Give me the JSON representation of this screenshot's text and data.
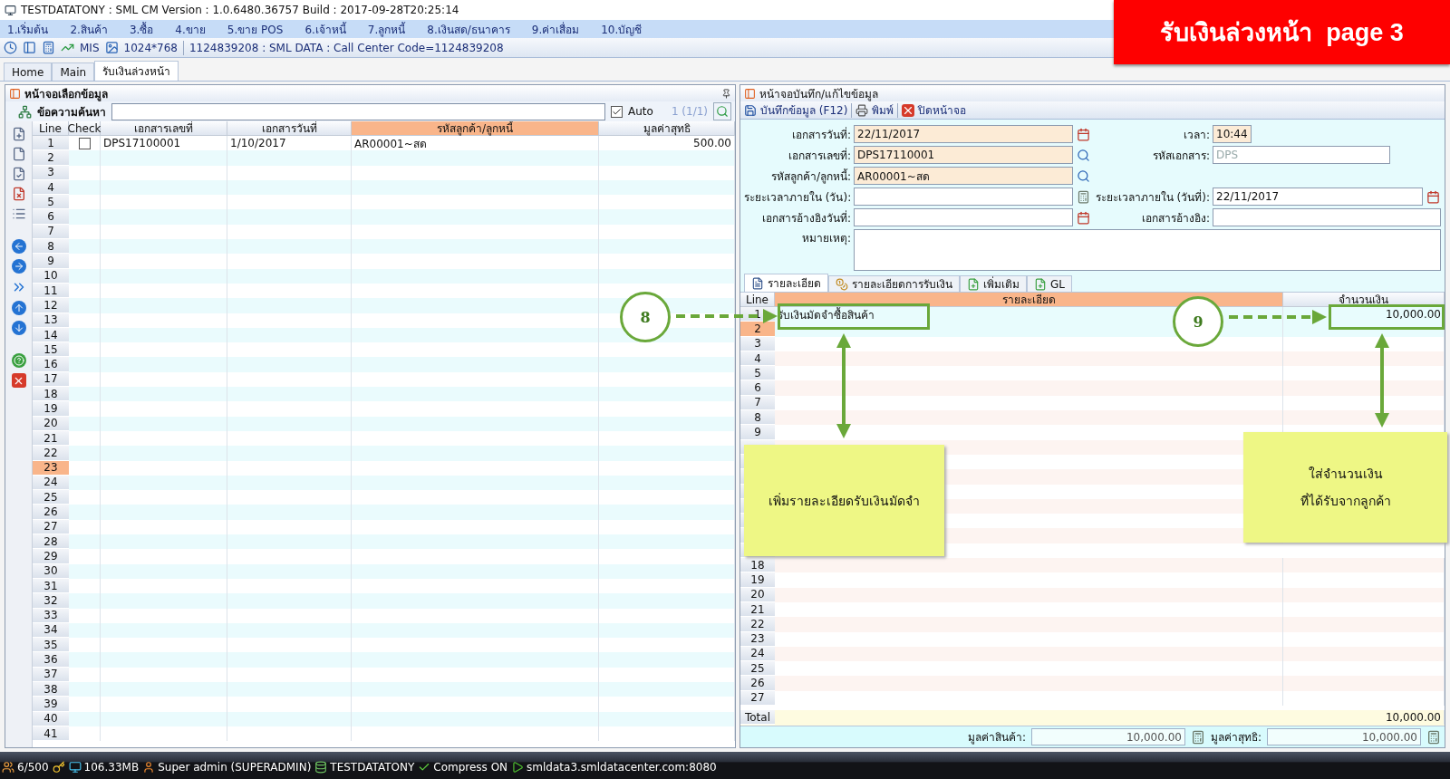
{
  "window": {
    "title": "TESTDATATONY : SML CM Version : 1.0.6480.36757  Build : 2017-09-28T20:25:14"
  },
  "banner": "รับเงินล่วงหน้า  page 3",
  "menu": [
    "1.เริ่มต้น",
    "2.สินค้า",
    "3.ซื้อ",
    "4.ขาย",
    "5.ขาย POS",
    "6.เจ้าหนี้",
    "7.ลูกหนี้",
    "8.เงินสด/ธนาคาร",
    "9.ค่าเสื่อม",
    "10.บัญชี"
  ],
  "toolbar": {
    "mis": "MIS",
    "resolution": "1024*768",
    "info": "1124839208 : SML DATA : Call Center Code=1124839208"
  },
  "tabs": [
    {
      "label": "Home",
      "selected": false
    },
    {
      "label": "Main",
      "selected": false
    },
    {
      "label": "รับเงินล่วงหน้า",
      "selected": true
    }
  ],
  "left_panel": {
    "title": "หน้าจอเลือกข้อมูล",
    "search_label": "ข้อความค้นหา",
    "auto": {
      "label": "Auto",
      "checked": true
    },
    "page_info": "1 (1/1)",
    "columns": [
      {
        "label": "Line",
        "sorted": false
      },
      {
        "label": "Check",
        "sorted": false
      },
      {
        "label": "เอกสารเลขที่",
        "sorted": false
      },
      {
        "label": "เอกสารวันที่",
        "sorted": false
      },
      {
        "label": "รหัสลูกค้า/ลูกหนี้",
        "sorted": true
      },
      {
        "label": "มูลค่าสุทธิ",
        "sorted": false
      }
    ],
    "rows": [
      {
        "line": "1",
        "selected": false,
        "checked": false,
        "doc_no": "DPS17100001",
        "doc_date": "1/10/2017",
        "customer": "AR00001~สด",
        "net_value": "500.00"
      },
      {
        "line": "2",
        "selected": false
      },
      {
        "line": "3",
        "selected": false
      },
      {
        "line": "4",
        "selected": false
      },
      {
        "line": "5",
        "selected": false
      },
      {
        "line": "6",
        "selected": false
      },
      {
        "line": "7",
        "selected": false
      },
      {
        "line": "8",
        "selected": false
      },
      {
        "line": "9",
        "selected": false
      },
      {
        "line": "10",
        "selected": false
      },
      {
        "line": "11",
        "selected": false
      },
      {
        "line": "12",
        "selected": false
      },
      {
        "line": "13",
        "selected": false
      },
      {
        "line": "14",
        "selected": false
      },
      {
        "line": "15",
        "selected": false
      },
      {
        "line": "16",
        "selected": false
      },
      {
        "line": "17",
        "selected": false
      },
      {
        "line": "18",
        "selected": false
      },
      {
        "line": "19",
        "selected": false
      },
      {
        "line": "20",
        "selected": false
      },
      {
        "line": "21",
        "selected": false
      },
      {
        "line": "22",
        "selected": false
      },
      {
        "line": "23",
        "selected": true
      },
      {
        "line": "24",
        "selected": false
      },
      {
        "line": "25",
        "selected": false
      },
      {
        "line": "26",
        "selected": false
      },
      {
        "line": "27",
        "selected": false
      },
      {
        "line": "28",
        "selected": false
      },
      {
        "line": "29",
        "selected": false
      },
      {
        "line": "30",
        "selected": false
      },
      {
        "line": "31",
        "selected": false
      },
      {
        "line": "32",
        "selected": false
      },
      {
        "line": "33",
        "selected": false
      },
      {
        "line": "34",
        "selected": false
      },
      {
        "line": "35",
        "selected": false
      },
      {
        "line": "36",
        "selected": false
      },
      {
        "line": "37",
        "selected": false
      },
      {
        "line": "38",
        "selected": false
      },
      {
        "line": "39",
        "selected": false
      },
      {
        "line": "40",
        "selected": false
      },
      {
        "line": "41",
        "selected": false
      }
    ]
  },
  "right_panel": {
    "title": "หน้าจอบันทึก/แก้ไขข้อมูล",
    "actions": [
      {
        "kind": "save",
        "label": "บันทึกข้อมูล (F12)"
      },
      {
        "kind": "print",
        "label": "พิมพ์"
      },
      {
        "kind": "close",
        "label": "ปิดหน้าจอ"
      }
    ],
    "form_rows": [
      {
        "left": {
          "kind": "date",
          "label": "เอกสารวันที่:",
          "value": "22/11/2017",
          "required": true
        },
        "right": {
          "kind": "text",
          "label": "เวลา:",
          "value": "10:44",
          "required": true
        }
      },
      {
        "left": {
          "kind": "lookup",
          "label": "เอกสารเลขที่:",
          "value": "DPS17110001",
          "required": true
        },
        "right": {
          "kind": "text",
          "label": "รหัสเอกสาร:",
          "value": "DPS",
          "disabled": true
        }
      },
      {
        "left": {
          "kind": "lookup",
          "label": "รหัสลูกค้า/ลูกหนี้:",
          "value": "AR00001~สด",
          "required": true
        }
      },
      {
        "left": {
          "kind": "number",
          "label": "ระยะเวลาภายใน (วัน):"
        },
        "right": {
          "kind": "date",
          "label": "ระยะเวลาภายใน (วันที่):",
          "value": "22/11/2017"
        }
      },
      {
        "left": {
          "kind": "date",
          "label": "เอกสารอ้างอิงวันที่:"
        },
        "right": {
          "kind": "text",
          "label": "เอกสารอ้างอิง:"
        }
      }
    ],
    "notes_label": "หมายเหตุ:",
    "tabs": [
      {
        "kind": "document",
        "label": "รายละเอียด",
        "selected": true
      },
      {
        "kind": "money",
        "label": "รายละเอียดการรับเงิน",
        "selected": false
      },
      {
        "kind": "add",
        "label": "เพิ่มเติม",
        "selected": false
      },
      {
        "kind": "add",
        "label": "GL",
        "selected": false
      }
    ],
    "columns": [
      {
        "label": "Line",
        "sorted": false
      },
      {
        "label": "รายละเอียด",
        "sorted": true
      },
      {
        "label": "จำนวนเงิน",
        "sorted": false
      }
    ],
    "rows": [
      {
        "line": "1",
        "selected": false,
        "detail": "รับเงินมัดจำซื้อสินค้า",
        "amount": "10,000.00"
      },
      {
        "line": "2",
        "selected": true
      },
      {
        "line": "3",
        "selected": false
      },
      {
        "line": "4",
        "selected": false
      },
      {
        "line": "5",
        "selected": false
      },
      {
        "line": "6",
        "selected": false
      },
      {
        "line": "7",
        "selected": false
      },
      {
        "line": "8",
        "selected": false
      },
      {
        "line": "9",
        "selected": false
      },
      {
        "selected": false
      },
      {
        "selected": false
      },
      {
        "selected": false
      },
      {
        "selected": false
      },
      {
        "selected": false
      },
      {
        "selected": false
      },
      {
        "selected": false
      },
      {
        "selected": false
      },
      {
        "line": "18",
        "selected": false
      },
      {
        "line": "19",
        "selected": false
      },
      {
        "line": "20",
        "selected": false
      },
      {
        "line": "21",
        "selected": false
      },
      {
        "line": "22",
        "selected": false
      },
      {
        "line": "23",
        "selected": false
      },
      {
        "line": "24",
        "selected": false
      },
      {
        "line": "25",
        "selected": false
      },
      {
        "line": "26",
        "selected": false
      },
      {
        "line": "27",
        "selected": false
      }
    ],
    "total": {
      "label": "Total",
      "amount": "10,000.00"
    },
    "footer": [
      {
        "label": "มูลค่าสินค้า:",
        "value": "10,000.00"
      },
      {
        "label": "มูลค่าสุทธิ:",
        "value": "10,000.00"
      }
    ]
  },
  "annotations": [
    {
      "number": "8",
      "note_lines": [
        "เพิ่มรายละเอียดรับเงินมัดจำ"
      ]
    },
    {
      "number": "9",
      "note_lines": [
        "ใส่จำนวนเงิน",
        "ที่ได้รับจากลูกค้า"
      ]
    }
  ],
  "status_bar": [
    {
      "kind": "users",
      "text": "6/500"
    },
    {
      "kind": "key"
    },
    {
      "kind": "memory",
      "text": "106.33MB"
    },
    {
      "kind": "user",
      "text": "Super admin (SUPERADMIN)"
    },
    {
      "kind": "database",
      "text": "TESTDATATONY"
    },
    {
      "kind": "check",
      "text": "Compress ON"
    },
    {
      "kind": "play",
      "text": "smldata3.smldatacenter.com:8080"
    }
  ]
}
